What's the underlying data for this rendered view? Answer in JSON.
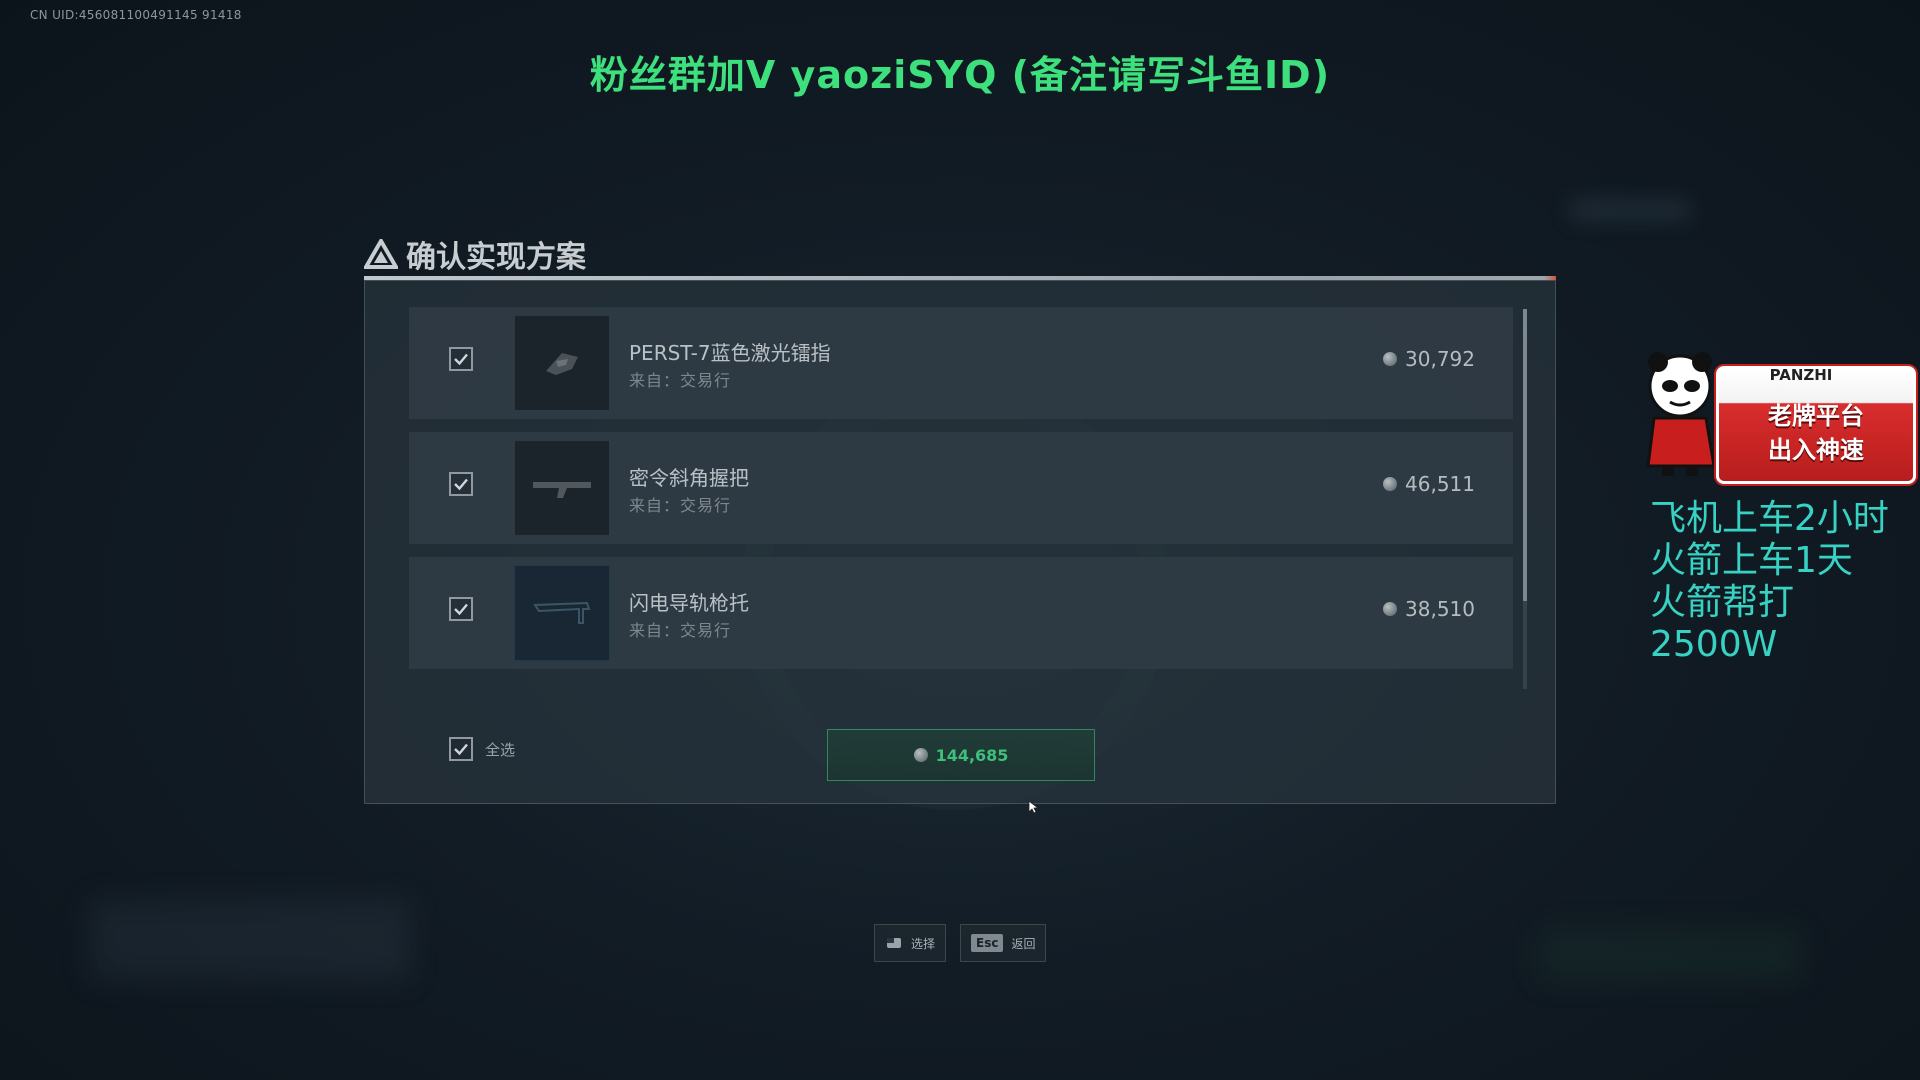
{
  "uid_text": "CN UID:456081100491145 91418",
  "banner": "粉丝群加V yaoziSYQ (备注请写斗鱼ID)",
  "dialog": {
    "title": "确认实现方案",
    "items": [
      {
        "name": "PERST-7蓝色激光镭指",
        "source": "来自：交易行",
        "price": "30,792",
        "checked": true
      },
      {
        "name": "密令斜角握把",
        "source": "来自：交易行",
        "price": "46,511",
        "checked": true
      },
      {
        "name": "闪电导轨枪托",
        "source": "来自：交易行",
        "price": "38,510",
        "checked": true
      }
    ],
    "select_all_label": "全选",
    "total": "144,685"
  },
  "hints": {
    "select_label": "选择",
    "esc_key": "Esc",
    "back_label": "返回"
  },
  "ad": {
    "brand": "PANZHI",
    "line1": "老牌平台",
    "line2": "出入神速",
    "text_lines": [
      "飞机上车2小时",
      "火箭上车1天",
      "火箭帮打2500W"
    ]
  },
  "colors": {
    "banner": "#3de07d",
    "confirm_accent": "#3fbf7c",
    "ad_text": "#37d2c3"
  }
}
